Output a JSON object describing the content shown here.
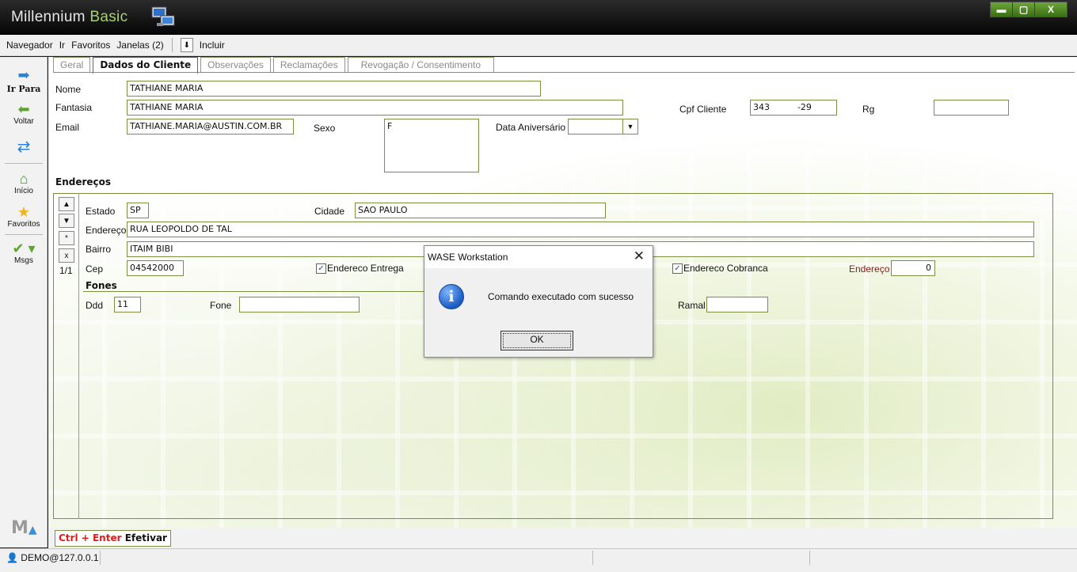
{
  "window": {
    "app_name": "Millennium",
    "app_edition": "Basic",
    "minimize": "▬",
    "maximize": "▢",
    "close": "X"
  },
  "menu": {
    "navegador": "Navegador",
    "ir": "Ir",
    "favoritos": "Favoritos",
    "janelas": "Janelas (2)",
    "incluir": "Incluir"
  },
  "sidebar": {
    "ir_para": "Ir Para",
    "voltar": "Voltar",
    "inicio": "Início",
    "favoritos": "Favoritos",
    "msgs": "Msgs"
  },
  "tabs": [
    "Geral",
    "Dados do Cliente",
    "Observações",
    "Reclamações",
    "Revogação / Consentimento"
  ],
  "cliente": {
    "nome_label": "Nome",
    "nome": "TATHIANE MARIA",
    "fantasia_label": "Fantasia",
    "fantasia": "TATHIANE MARIA",
    "email_label": "Email",
    "email": "TATHIANE.MARIA@AUSTIN.COM.BR",
    "sexo_label": "Sexo",
    "sexo": "F",
    "aniversario_label": "Data Aniversário",
    "aniversario": "",
    "cpf_label": "Cpf Cliente",
    "cpf": "343          -29",
    "rg_label": "Rg",
    "rg": ""
  },
  "enderecos": {
    "title": "Endereços",
    "nav": {
      "up": "▲",
      "down": "▼",
      "new": "*",
      "delete": "x",
      "record": "1/1"
    },
    "estado_label": "Estado",
    "estado": "SP",
    "cidade_label": "Cidade",
    "cidade": "SAO PAULO",
    "endereco_label": "Endereço",
    "endereco": "RUA LEOPOLDO DE TAL",
    "bairro_label": "Bairro",
    "bairro": "ITAIM BIBI",
    "cep_label": "Cep",
    "cep": "04542000",
    "entrega_label": "Endereco Entrega",
    "cobranca_label": "Endereco Cobranca",
    "endereco_num_label": "Endereço",
    "endereco_num": "0",
    "fones_title": "Fones",
    "ddd_label": "Ddd",
    "ddd": "11",
    "fone_label": "Fone",
    "fone": "",
    "ramal_label": "Ramal",
    "ramal": ""
  },
  "dialog": {
    "title": "WASE Workstation",
    "message": "Comando executado com sucesso",
    "ok": "OK"
  },
  "footer": {
    "shortcut": "Ctrl + Enter",
    "action": "Efetivar",
    "user": "DEMO@127.0.0.1"
  }
}
